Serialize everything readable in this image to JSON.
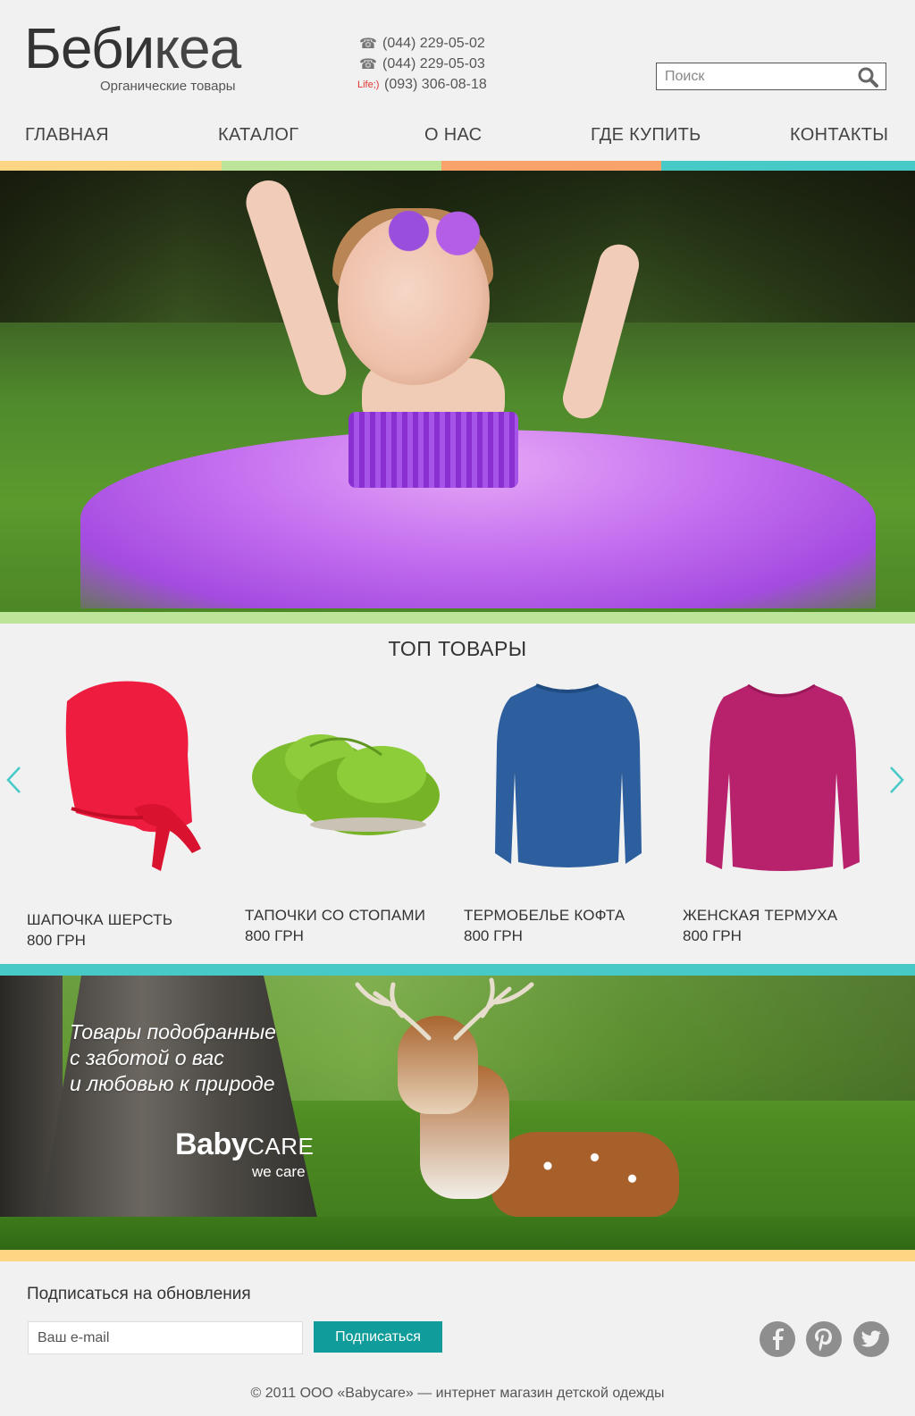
{
  "header": {
    "logo_title_bold": "Беби",
    "logo_title_thin": "кеа",
    "logo_subtitle": "Органические товары",
    "phones": [
      {
        "icon": "phone-icon",
        "number": "(044) 229-05-02"
      },
      {
        "icon": "phone-icon",
        "number": "(044) 229-05-03"
      },
      {
        "label": "Life;)",
        "number": "(093) 306-08-18"
      }
    ],
    "search": {
      "placeholder": "Поиск",
      "icon": "search-icon"
    }
  },
  "nav": {
    "items": [
      "ГЛАВНАЯ",
      "КАТАЛОГ",
      "О НАС",
      "ГДЕ КУПИТЬ",
      "КОНТАКТЫ"
    ],
    "stripe_colors": [
      "#fdd583",
      "#bde59a",
      "#f9a36a",
      "#47cac7"
    ]
  },
  "top_products": {
    "title": "ТОП ТОВАРЫ",
    "items": [
      {
        "name": "ШАПОЧКА ШЕРСТЬ",
        "price": "800 ГРН",
        "color": "#ee1d3f"
      },
      {
        "name": "ТАПОЧКИ СО СТОПАМИ",
        "price": "800 ГРН",
        "color": "#7dbb2e"
      },
      {
        "name": "ТЕРМОБЕЛЬЕ КОФТА",
        "price": "800 ГРН",
        "color": "#2d5f9e"
      },
      {
        "name": "ЖЕНСКАЯ ТЕРМУХА",
        "price": "800 ГРН",
        "color": "#b8226d"
      }
    ]
  },
  "banner": {
    "slogan": "Товары подобранные\nс заботой о вас\nи любовью к природе",
    "brand_bold": "Baby",
    "brand_care": "CARE",
    "brand_sub": "we care"
  },
  "footer": {
    "subscribe_title": "Подписаться на обновления",
    "email_placeholder": "Ваш e-mail",
    "subscribe_button": "Подписаться",
    "social": [
      "facebook-icon",
      "pinterest-icon",
      "twitter-icon"
    ],
    "copyright": "© 2011 ООО «Babycare» — интернет магазин детской одежды"
  },
  "colors": {
    "accent_teal": "#0f9c9a",
    "arrow": "#47cac7"
  }
}
